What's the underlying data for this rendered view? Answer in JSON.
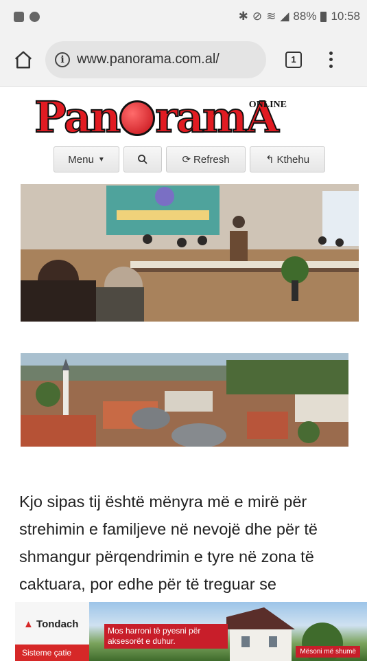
{
  "status_bar": {
    "battery": "88%",
    "time": "10:58"
  },
  "browser": {
    "url": "www.panorama.com.al/",
    "tab_count": "1"
  },
  "site": {
    "logo_text": "PanoramA",
    "logo_tag": "ONLINE",
    "nav": {
      "menu_label": "Menu",
      "refresh_label": "Refresh",
      "back_label": "Kthehu"
    }
  },
  "article": {
    "text": "Kjo sipas tij është mënyra më e mirë për strehimin e familjeve në nevojë dhe për të shmangur përqendrimin e tyre në zona të caktuara, por edhe për të treguar se"
  },
  "ad": {
    "brand": "Tondach",
    "sub": "Sisteme çatie",
    "message": "Mos harroni të pyesni për aksesorët e duhur.",
    "cta": "Mësoni më shumë"
  },
  "colors": {
    "brand_red": "#e11b22",
    "chrome_bg": "#f2f2f2"
  },
  "icons": [
    "home-icon",
    "info-icon",
    "tabs-icon",
    "overflow-menu-icon",
    "search-icon",
    "refresh-icon",
    "reply-icon",
    "chevron-down-icon"
  ]
}
